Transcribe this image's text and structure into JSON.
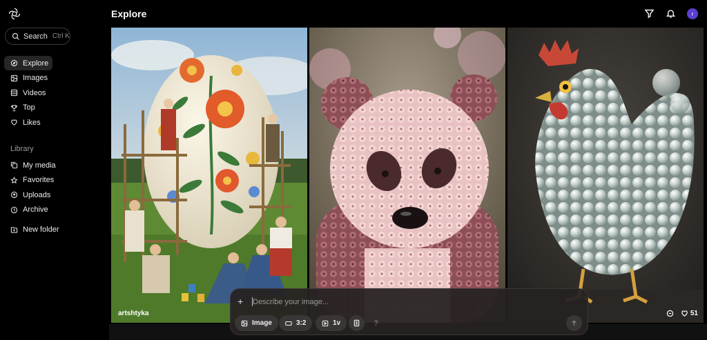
{
  "header": {
    "title": "Explore",
    "avatar_letter": "r"
  },
  "search": {
    "label": "Search",
    "shortcut": "Ctrl K"
  },
  "nav": [
    {
      "label": "Explore",
      "icon": "compass-icon",
      "active": true
    },
    {
      "label": "Images",
      "icon": "image-icon"
    },
    {
      "label": "Videos",
      "icon": "video-icon"
    },
    {
      "label": "Top",
      "icon": "trophy-icon"
    },
    {
      "label": "Likes",
      "icon": "heart-icon"
    }
  ],
  "library": {
    "title": "Library",
    "items": [
      {
        "label": "My media",
        "icon": "media-icon"
      },
      {
        "label": "Favorites",
        "icon": "star-icon"
      },
      {
        "label": "Uploads",
        "icon": "upload-icon"
      },
      {
        "label": "Archive",
        "icon": "archive-icon"
      },
      {
        "label": "New folder",
        "icon": "new-folder-icon"
      }
    ]
  },
  "tiles": [
    {
      "author": "artshtyka",
      "subject": "painted-egg"
    },
    {
      "subject": "flower-panda"
    },
    {
      "subject": "bubble-chicken",
      "likes": "51"
    }
  ],
  "prompt": {
    "placeholder": "Describe your image...",
    "mode": "Image",
    "ratio": "3:2",
    "variations": "1v",
    "help": "?"
  },
  "colors": {
    "avatar": "#5b3fd1",
    "background": "#000000"
  }
}
